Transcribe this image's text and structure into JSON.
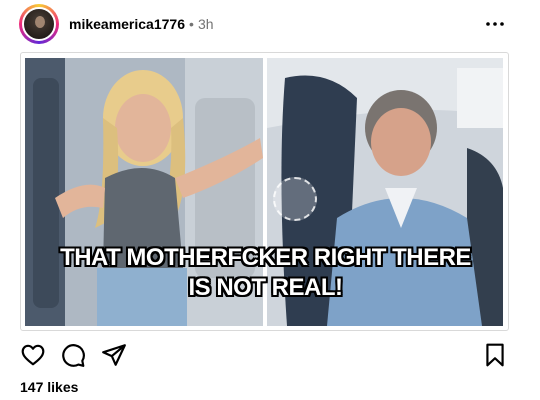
{
  "post": {
    "username": "mikeamerica1776",
    "separator": "•",
    "time": "3h",
    "more_icon": "more-horizontal-icon",
    "image": {
      "caption_line1": "THAT MOTHERFCKER RIGHT THERE",
      "caption_line2": "IS NOT REAL!"
    },
    "actions": {
      "like_icon": "heart-icon",
      "comment_icon": "comment-icon",
      "share_icon": "send-icon",
      "save_icon": "bookmark-icon"
    },
    "likes": "147 likes"
  },
  "colors": {
    "text": "#000000",
    "muted": "#737373",
    "border": "#d9d9d9"
  }
}
